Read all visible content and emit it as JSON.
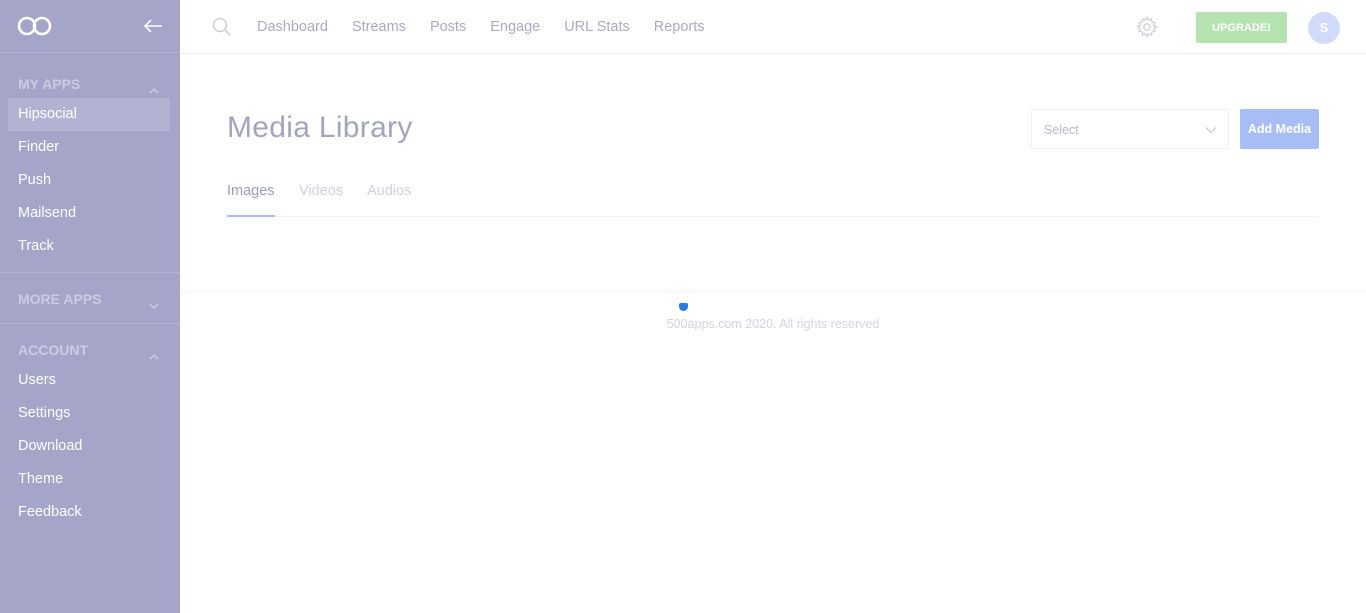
{
  "sidebar": {
    "my_apps_title": "MY APPS",
    "my_apps": [
      {
        "label": "Hipsocial"
      },
      {
        "label": "Finder"
      },
      {
        "label": "Push"
      },
      {
        "label": "Mailsend"
      },
      {
        "label": "Track"
      }
    ],
    "more_apps_title": "MORE APPS",
    "account_title": "ACCOUNT",
    "account": [
      {
        "label": "Users"
      },
      {
        "label": "Settings"
      },
      {
        "label": "Download"
      },
      {
        "label": "Theme"
      },
      {
        "label": "Feedback"
      }
    ],
    "active_item": "Hipsocial"
  },
  "topbar": {
    "nav": [
      {
        "label": "Dashboard"
      },
      {
        "label": "Streams"
      },
      {
        "label": "Posts"
      },
      {
        "label": "Engage"
      },
      {
        "label": "URL Stats"
      },
      {
        "label": "Reports"
      }
    ],
    "upgrade_label": "UPGRADE!",
    "avatar_initial": "S"
  },
  "main": {
    "title": "Media Library",
    "select_value": "Select",
    "add_media_label": "Add Media",
    "tabs": [
      {
        "label": "Images",
        "active": true
      },
      {
        "label": "Videos",
        "active": false
      },
      {
        "label": "Audios",
        "active": false
      }
    ]
  },
  "footer": {
    "text": "500apps.com 2020. All rights reserved"
  },
  "colors": {
    "sidebar_bg": "#a4a5c9",
    "upgrade_bg": "#b5e3b0",
    "add_media_bg": "#a7bdf6",
    "avatar_bg": "#d3dbfb",
    "accent": "#a9bcf3"
  },
  "icons": {
    "logo": "infinity-logo-icon",
    "collapse": "arrow-left-icon",
    "search": "search-icon",
    "settings": "gear-icon",
    "section_toggle": "chevron-icon"
  }
}
